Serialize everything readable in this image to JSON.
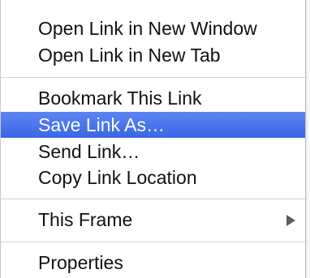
{
  "menu": {
    "items": [
      {
        "label": "Open Link in New Window"
      },
      {
        "label": "Open Link in New Tab"
      },
      {
        "label": "Bookmark This Link"
      },
      {
        "label": "Save Link As…"
      },
      {
        "label": "Send Link…"
      },
      {
        "label": "Copy Link Location"
      },
      {
        "label": "This Frame"
      },
      {
        "label": "Properties"
      }
    ],
    "highlighted_item": "Save Link As…",
    "submenu_arrow_icon": "chevron-right-icon",
    "colors": {
      "highlight": "#3a66e6",
      "highlight_text": "#ffffff",
      "text": "#111111",
      "separator": "#d4d4d4"
    }
  }
}
